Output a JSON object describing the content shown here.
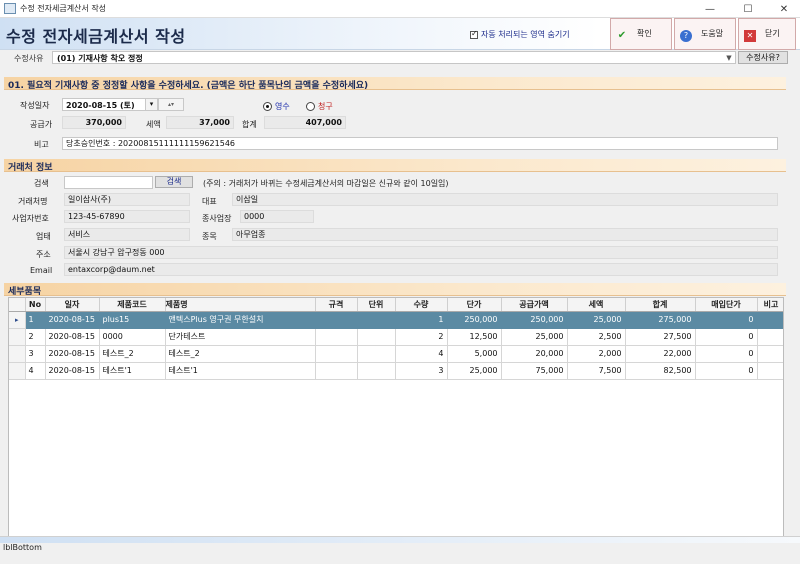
{
  "window": {
    "title": "수정 전자세금계산서 작성",
    "minimize": "—",
    "maximize": "☐",
    "close": "✕"
  },
  "header": {
    "title": "수정 전자세금계산서 작성",
    "autohide_label": "자동 처리되는 영역 숨기기",
    "buttons": {
      "confirm": "확인",
      "help": "도움말",
      "close": "닫기"
    }
  },
  "reason": {
    "label": "수정사유",
    "value": "(01) 기재사항 착오 정정",
    "button": "수정사유?"
  },
  "section1": {
    "title": "01. 필요적 기재사항 중 정정할 사항을 수정하세요. (금액은 하단 품목난의 금액을 수정하세요)"
  },
  "basic": {
    "date_label": "작성일자",
    "date_value": "2020-08-15 (토)",
    "receipt_label": "영수",
    "claim_label": "청구",
    "supply_label": "공급가",
    "supply_value": "370,000",
    "tax_label": "세액",
    "tax_value": "37,000",
    "total_label": "합계",
    "total_value": "407,000",
    "note_label": "비고",
    "note_value": "당초승인번호 : 20200815111111159621546"
  },
  "section2": {
    "title": "거래처 정보"
  },
  "partner": {
    "search_label": "검색",
    "search_value": "",
    "search_button": "검색",
    "search_note": "(주의 : 거래처가 바뀌는 수정세금계산서의 마감일은 신규와 같이 10일임)",
    "name_label": "거래처명",
    "name_value": "일이삼사(주)",
    "ceo_label": "대표",
    "ceo_value": "이삼일",
    "bizno_label": "사업자번호",
    "bizno_value": "123-45-67890",
    "branch_label": "종사업장",
    "branch_value": "0000",
    "biztype_label": "업태",
    "biztype_value": "서비스",
    "bizitem_label": "종목",
    "bizitem_value": "아무업종",
    "address_label": "주소",
    "address_value": "서울시 강남구 압구정동 000",
    "email_label": "Email",
    "email_value": "entaxcorp@daum.net"
  },
  "section3": {
    "title": "세부품목"
  },
  "items": {
    "columns": [
      "No",
      "일자",
      "제품코드",
      "제품명",
      "규격",
      "단위",
      "수량",
      "단가",
      "공급가액",
      "세액",
      "합계",
      "매입단가",
      "비고"
    ],
    "rows": [
      {
        "marker": "▸",
        "no": "1",
        "date": "2020-08-15",
        "code": "plus15",
        "name": "앤텍스Plus 영구권 무한설치",
        "spec": "",
        "unit": "",
        "qty": "1",
        "price": "250,000",
        "supply": "250,000",
        "tax": "25,000",
        "total": "275,000",
        "buy": "0",
        "note": ""
      },
      {
        "marker": "",
        "no": "2",
        "date": "2020-08-15",
        "code": "0000",
        "name": "단가테스트",
        "spec": "",
        "unit": "",
        "qty": "2",
        "price": "12,500",
        "supply": "25,000",
        "tax": "2,500",
        "total": "27,500",
        "buy": "0",
        "note": ""
      },
      {
        "marker": "",
        "no": "3",
        "date": "2020-08-15",
        "code": "테스트_2",
        "name": "테스트_2",
        "spec": "",
        "unit": "",
        "qty": "4",
        "price": "5,000",
        "supply": "20,000",
        "tax": "2,000",
        "total": "22,000",
        "buy": "0",
        "note": ""
      },
      {
        "marker": "",
        "no": "4",
        "date": "2020-08-15",
        "code": "테스트'1",
        "name": "테스트'1",
        "spec": "",
        "unit": "",
        "qty": "3",
        "price": "25,000",
        "supply": "75,000",
        "tax": "7,500",
        "total": "82,500",
        "buy": "0",
        "note": ""
      }
    ]
  },
  "status": {
    "text": "lblBottom"
  }
}
